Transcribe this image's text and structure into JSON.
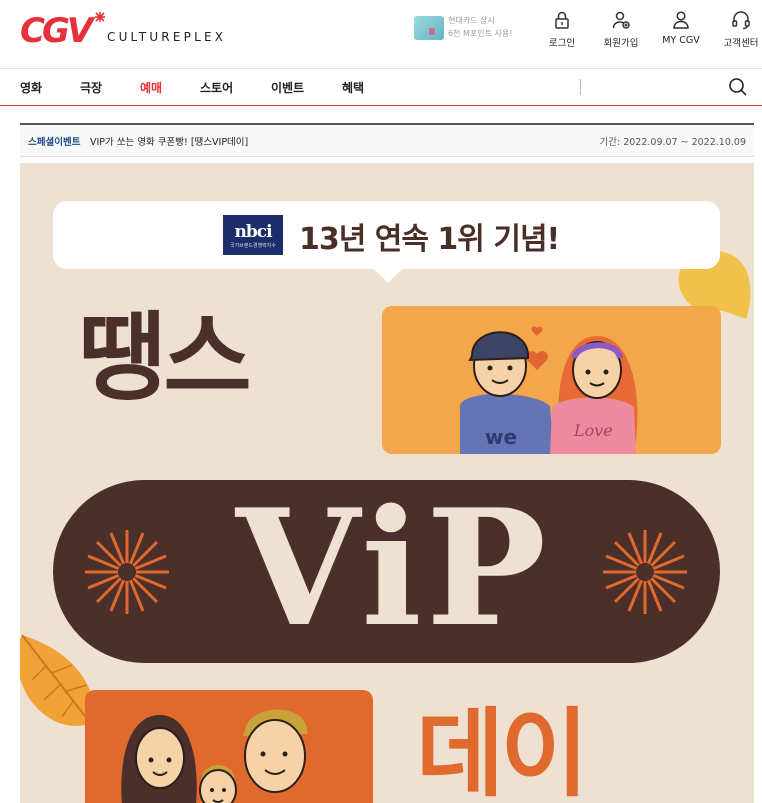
{
  "header": {
    "brand_sub": "CULTUREPLEX",
    "promo_line1": "현대카드 상시",
    "promo_line2": "6천 M포인트 사용!",
    "utils": [
      {
        "label": "로그인",
        "icon": "lock-icon"
      },
      {
        "label": "회원가입",
        "icon": "user-plus-icon"
      },
      {
        "label": "MY CGV",
        "icon": "user-icon"
      },
      {
        "label": "고객센터",
        "icon": "headset-icon"
      }
    ]
  },
  "nav": {
    "items": [
      "영화",
      "극장",
      "예매",
      "스토어",
      "이벤트",
      "혜택"
    ],
    "active_index": 2
  },
  "event": {
    "category": "스페셜이벤트",
    "title": "VIP가 쏘는 영화 쿠폰빵! [땡스VIP데이]",
    "period": "기간: 2022.09.07 ~ 2022.10.09"
  },
  "banner": {
    "bubble_text": "13년 연속 1위 기념!",
    "nbci_logo": "nbci",
    "nbci_small": "국가브랜드경쟁력지수",
    "title_top": "땡스",
    "title_vip": "ViP",
    "title_bottom": "데이",
    "shirt_left": "we",
    "shirt_right": "Love"
  },
  "colors": {
    "brand_red": "#e7303a",
    "banner_bg": "#efe1d1",
    "brown": "#4a2f2a",
    "orange": "#e06a2e",
    "couple_bg": "#f3a64a"
  }
}
